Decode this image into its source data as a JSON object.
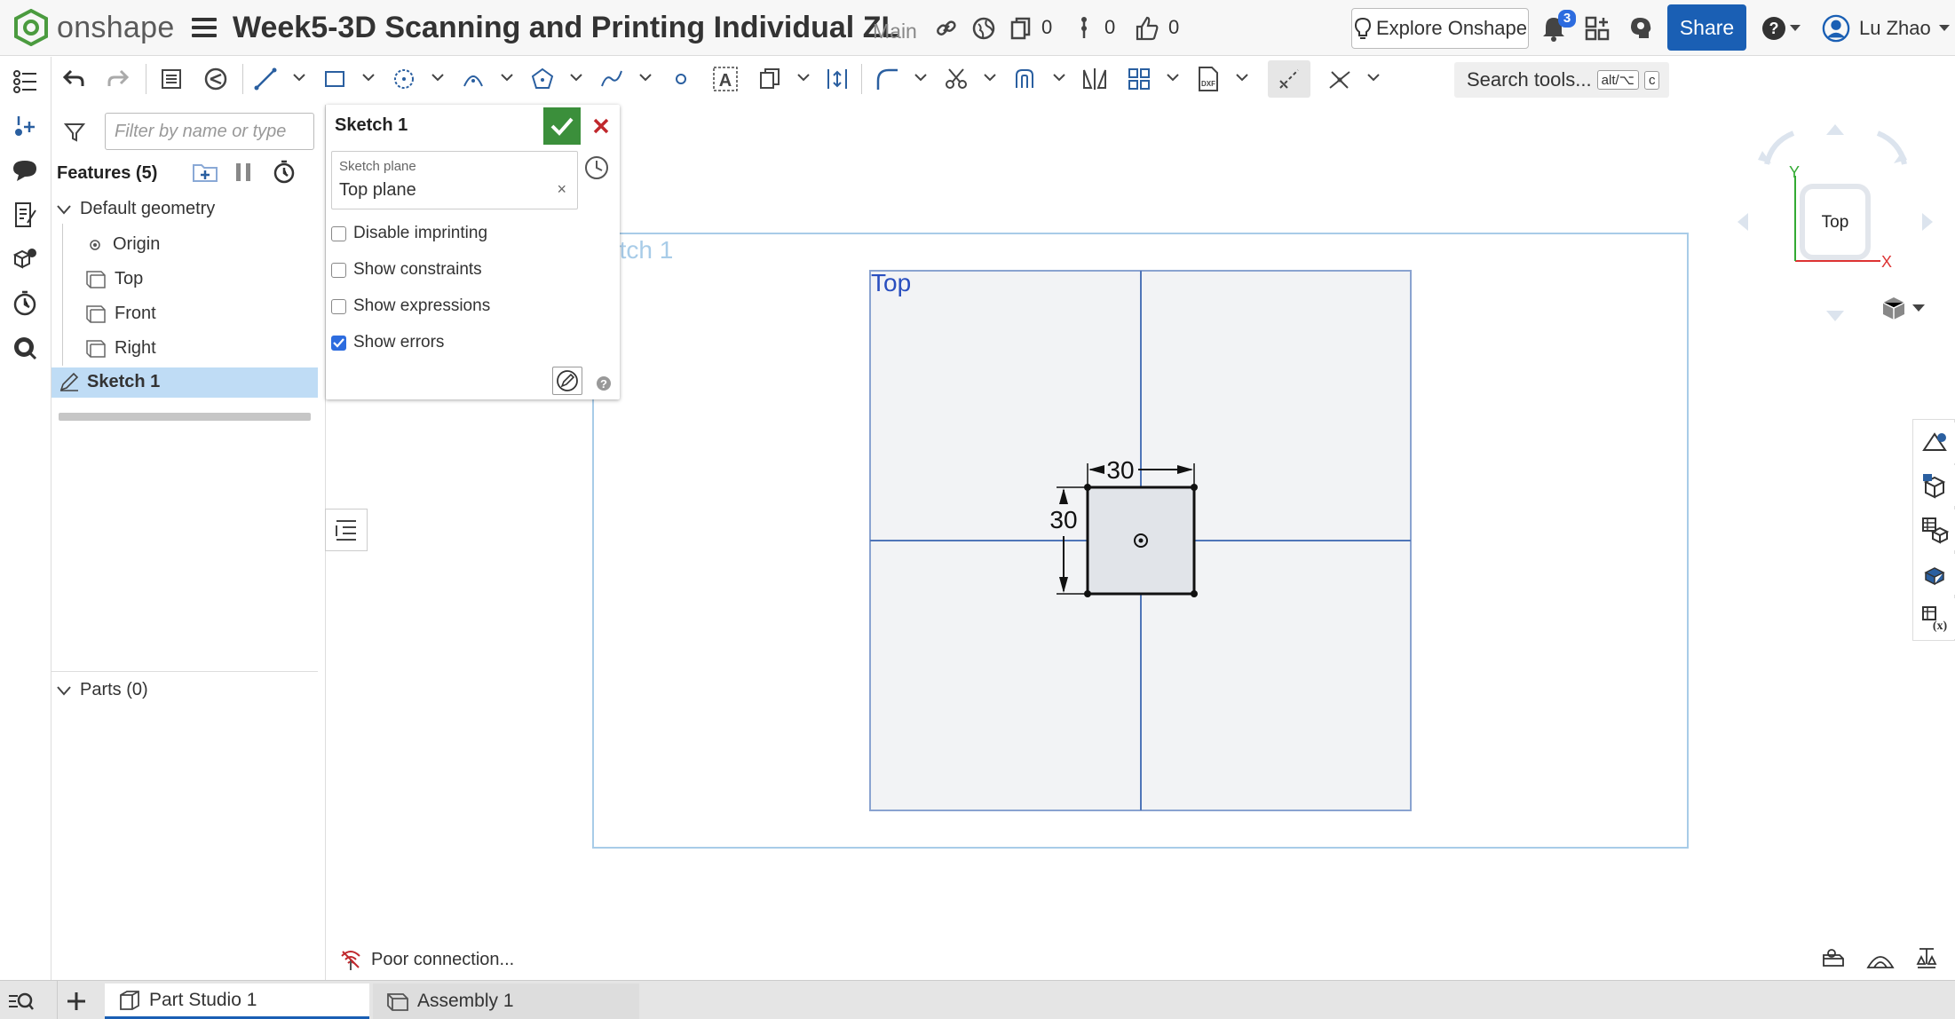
{
  "app": {
    "logo_text": "onshape",
    "doc_title": "Week5-3D Scanning and Printing Individual ZL",
    "branch": "Main",
    "copies_count": "0",
    "versions_count": "0",
    "likes_count": "0",
    "explore_label": "Explore Onshape",
    "notifications_count": "3",
    "share_label": "Share",
    "user_name": "Lu Zhao",
    "accent_color": "#1a5fb4"
  },
  "toolbar": {
    "search_label": "Search tools...",
    "shortcut_mod": "alt/⌥",
    "shortcut_key": "c"
  },
  "features": {
    "filter_placeholder": "Filter by name or type",
    "header": "Features (5)",
    "default_geometry": "Default geometry",
    "items": [
      {
        "label": "Origin",
        "icon": "origin-icon"
      },
      {
        "label": "Top",
        "icon": "plane-icon"
      },
      {
        "label": "Front",
        "icon": "plane-icon"
      },
      {
        "label": "Right",
        "icon": "plane-icon"
      }
    ],
    "sketch": "Sketch 1",
    "parts": "Parts (0)"
  },
  "dialog": {
    "title": "Sketch 1",
    "plane_label": "Sketch plane",
    "plane_value": "Top plane",
    "plane_clear": "×",
    "options": [
      {
        "label": "Disable imprinting",
        "checked": false
      },
      {
        "label": "Show constraints",
        "checked": false
      },
      {
        "label": "Show expressions",
        "checked": false
      },
      {
        "label": "Show errors",
        "checked": true
      }
    ]
  },
  "canvas": {
    "sketch_label": "ketch 1",
    "plane_label": "Top",
    "dim_width": "30",
    "dim_height": "30"
  },
  "viewcube": {
    "face": "Top",
    "axis_y": "Y",
    "axis_x": "X"
  },
  "status": {
    "text": "Poor connection..."
  },
  "tabs": [
    {
      "label": "Part Studio 1",
      "active": true
    },
    {
      "label": "Assembly 1",
      "active": false
    }
  ]
}
